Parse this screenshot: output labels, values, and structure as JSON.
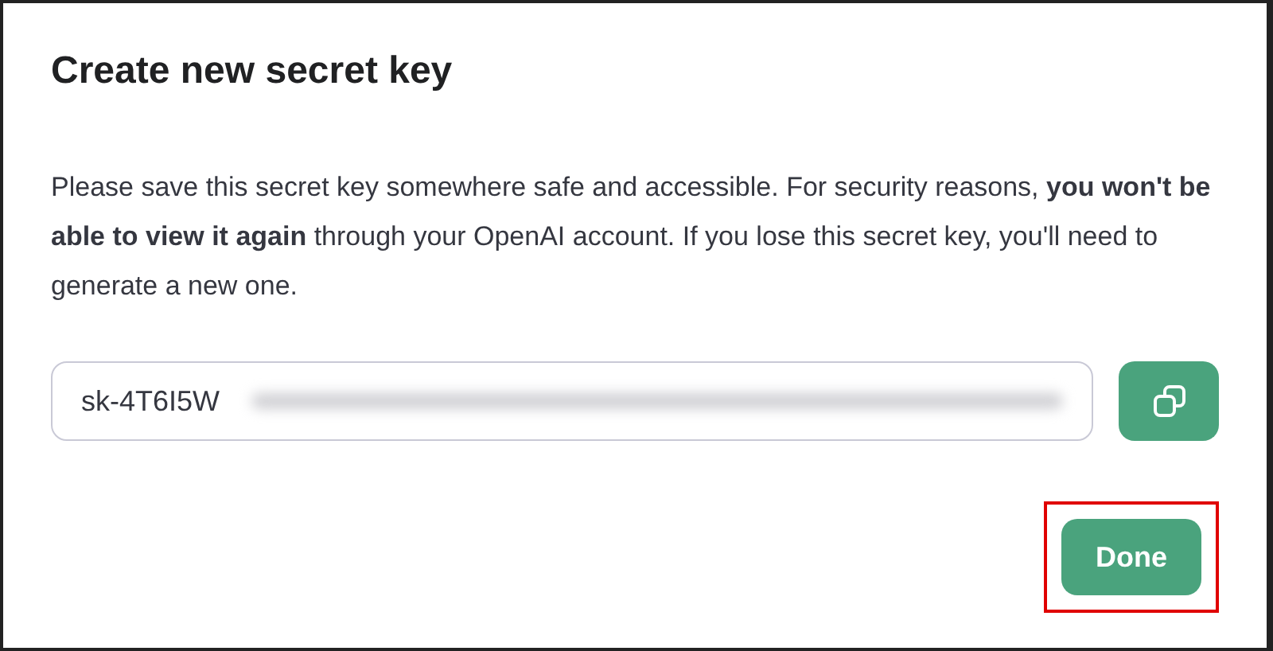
{
  "dialog": {
    "title": "Create new secret key",
    "message": "Please save this secret key somewhere safe and accessible. For security reasons, **you won't be able to view it again** through your OpenAI account. If you lose this secret key, you'll need to generate a new one.",
    "key_field": {
      "value": "sk-4T6I5W"
    },
    "buttons": [
      {
        "label": "Done",
        "highlighted": true
      }
    ]
  }
}
